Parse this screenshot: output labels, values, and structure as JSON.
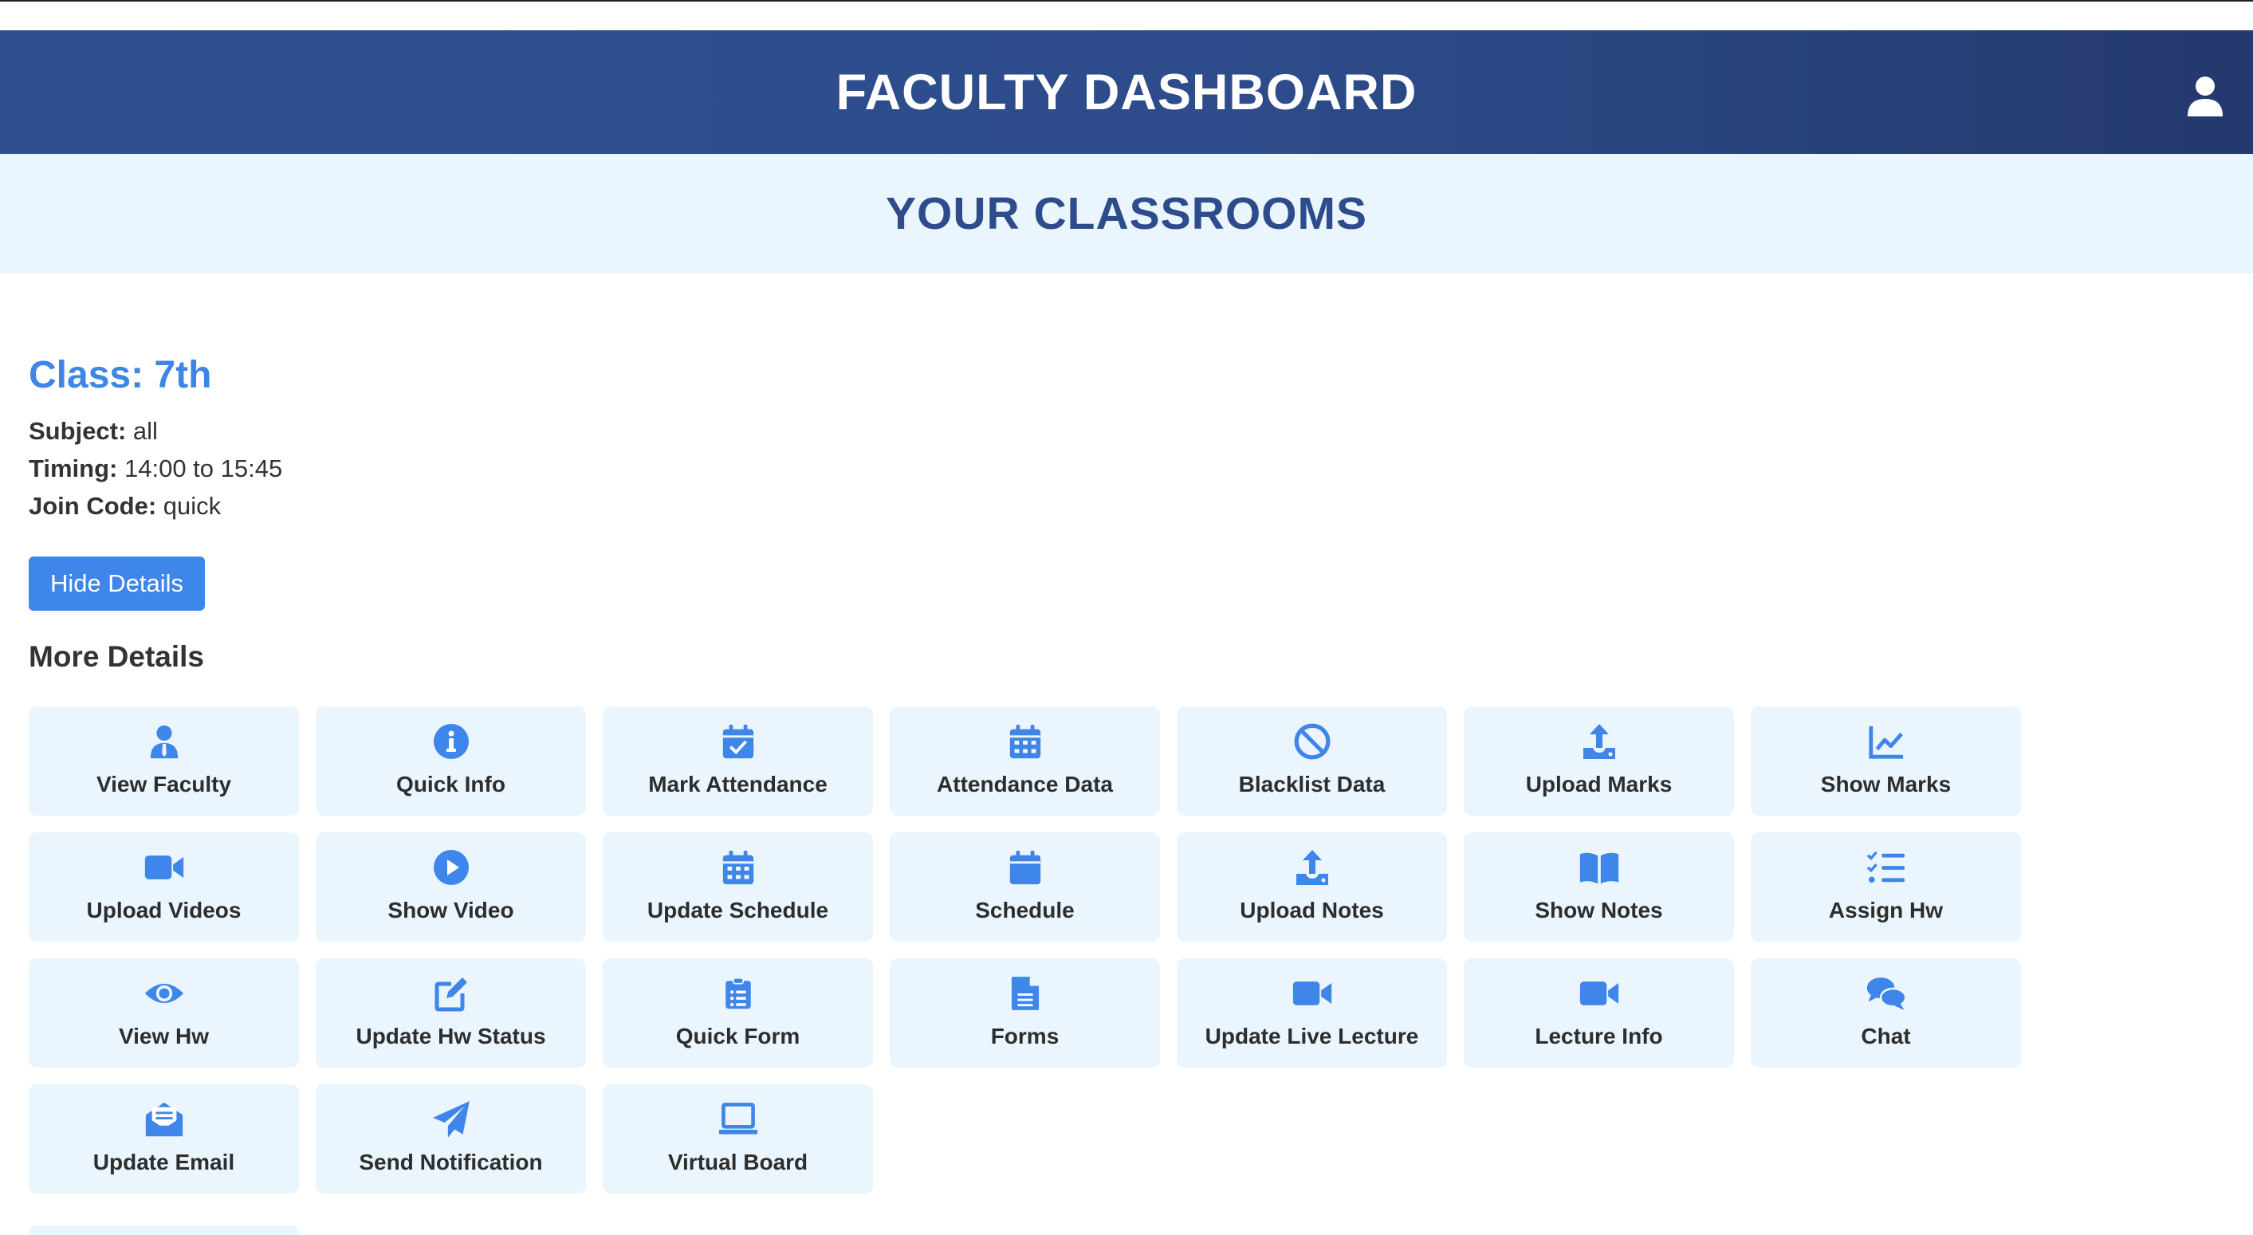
{
  "header": {
    "title": "FACULTY DASHBOARD",
    "user_icon": "user-icon"
  },
  "band": {
    "title": "YOUR CLASSROOMS"
  },
  "classroom": {
    "title": "Class: 7th",
    "subject_label": "Subject:",
    "subject_value": " all",
    "timing_label": "Timing:",
    "timing_value": " 14:00 to 15:45",
    "code_label": "Join Code:",
    "code_value": " quick",
    "hide_button": "Hide Details",
    "more_title": "More Details"
  },
  "colors": {
    "header": "#2e4c8b",
    "accent": "#3f86ea",
    "tile_bg": "#ebf5fd",
    "title_blue": "#3d86e6"
  },
  "tiles": [
    {
      "label": "View Faculty",
      "icon": "faculty-icon"
    },
    {
      "label": "Quick Info",
      "icon": "info-icon"
    },
    {
      "label": "Mark Attendance",
      "icon": "calendar-check-icon"
    },
    {
      "label": "Attendance Data",
      "icon": "calendar-grid-icon"
    },
    {
      "label": "Blacklist Data",
      "icon": "ban-icon"
    },
    {
      "label": "Upload Marks",
      "icon": "upload-icon"
    },
    {
      "label": "Show Marks",
      "icon": "chart-line-icon"
    },
    {
      "label": "Upload Videos",
      "icon": "video-icon"
    },
    {
      "label": "Show Video",
      "icon": "play-circle-icon"
    },
    {
      "label": "Update Schedule",
      "icon": "calendar-grid-icon"
    },
    {
      "label": "Schedule",
      "icon": "calendar-icon"
    },
    {
      "label": "Upload Notes",
      "icon": "upload-icon"
    },
    {
      "label": "Show Notes",
      "icon": "book-icon"
    },
    {
      "label": "Assign Hw",
      "icon": "list-check-icon"
    },
    {
      "label": "View Hw",
      "icon": "eye-icon"
    },
    {
      "label": "Update Hw Status",
      "icon": "edit-icon"
    },
    {
      "label": "Quick Form",
      "icon": "clipboard-list-icon"
    },
    {
      "label": "Forms",
      "icon": "file-lines-icon"
    },
    {
      "label": "Update Live Lecture",
      "icon": "video-icon"
    },
    {
      "label": "Lecture Info",
      "icon": "video-icon"
    },
    {
      "label": "Chat",
      "icon": "comments-icon"
    },
    {
      "label": "Update Email",
      "icon": "envelope-open-icon"
    },
    {
      "label": "Send Notification",
      "icon": "paper-plane-icon"
    },
    {
      "label": "Virtual Board",
      "icon": "laptop-icon"
    }
  ]
}
